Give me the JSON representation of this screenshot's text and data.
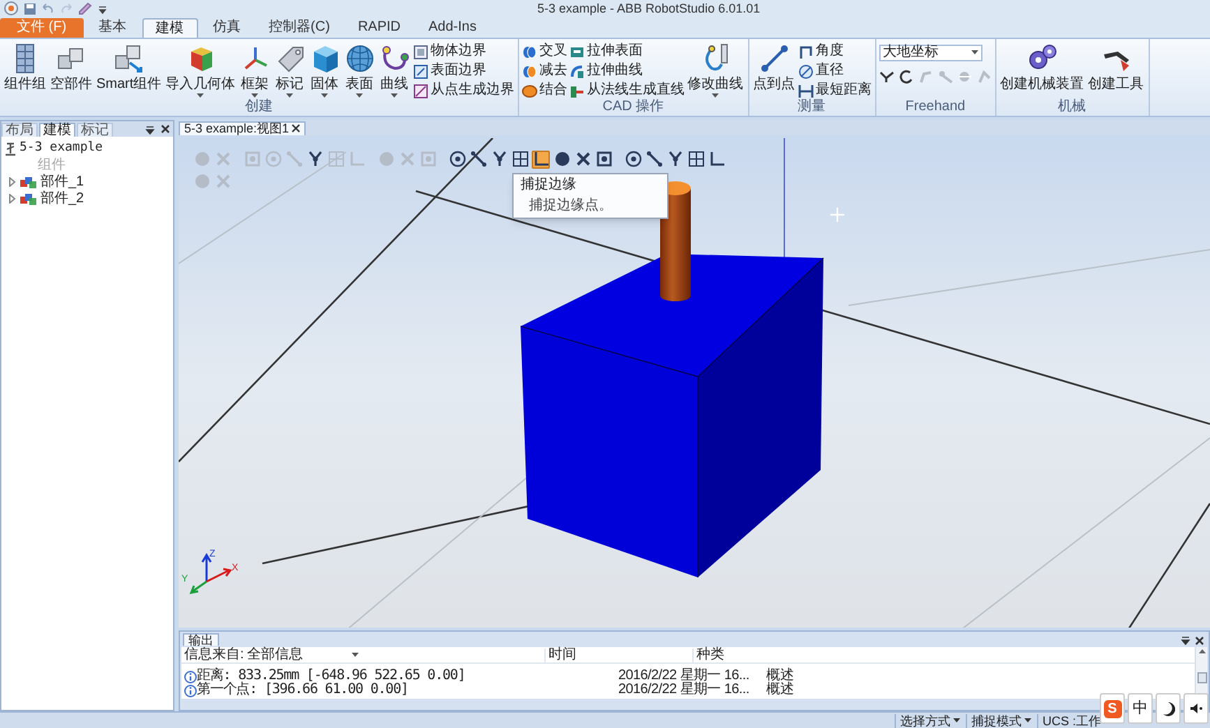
{
  "window": {
    "title": "5-3 example - ABB RobotStudio 6.01.01"
  },
  "ribbon": {
    "tabs": [
      {
        "label": "文件 (F)",
        "kind": "file",
        "selected": false
      },
      {
        "label": "基本",
        "kind": "tab",
        "selected": false
      },
      {
        "label": "建模",
        "kind": "tab",
        "selected": true
      },
      {
        "label": "仿真",
        "kind": "tab",
        "selected": false
      },
      {
        "label": "控制器(C)",
        "kind": "tab",
        "selected": false
      },
      {
        "label": "RAPID",
        "kind": "tab",
        "selected": false
      },
      {
        "label": "Add-Ins",
        "kind": "tab",
        "selected": false
      }
    ],
    "groups": [
      {
        "label": "创建",
        "items": [
          {
            "kind": "large",
            "label": "组件组",
            "dropdown": false
          },
          {
            "kind": "large",
            "label": "空部件",
            "dropdown": false
          },
          {
            "kind": "large",
            "label": "Smart组件",
            "dropdown": false
          },
          {
            "kind": "large",
            "label": "导入几何体",
            "dropdown": true
          },
          {
            "kind": "large",
            "label": "框架",
            "dropdown": true
          },
          {
            "kind": "large",
            "label": "标记",
            "dropdown": true
          },
          {
            "kind": "large",
            "label": "固体",
            "dropdown": true
          },
          {
            "kind": "large",
            "label": "表面",
            "dropdown": true
          },
          {
            "kind": "large",
            "label": "曲线",
            "dropdown": true
          },
          {
            "kind": "column",
            "items": [
              {
                "label": "物体边界"
              },
              {
                "label": "表面边界"
              },
              {
                "label": "从点生成边界"
              }
            ]
          }
        ]
      },
      {
        "label": "CAD 操作",
        "items": [
          {
            "kind": "column",
            "items": [
              {
                "label": "交叉"
              },
              {
                "label": "减去"
              },
              {
                "label": "结合"
              }
            ]
          },
          {
            "kind": "column",
            "items": [
              {
                "label": "拉伸表面"
              },
              {
                "label": "拉伸曲线"
              },
              {
                "label": "从法线生成直线"
              }
            ]
          },
          {
            "kind": "large",
            "label": "修改曲线",
            "dropdown": true
          }
        ]
      },
      {
        "label": "测量",
        "items": [
          {
            "kind": "large",
            "label": "点到点",
            "dropdown": false
          },
          {
            "kind": "column",
            "items": [
              {
                "label": "角度"
              },
              {
                "label": "直径"
              },
              {
                "label": "最短距离"
              }
            ]
          }
        ]
      },
      {
        "label": "Freehand",
        "items": [
          {
            "kind": "dropdown",
            "value": "大地坐标"
          }
        ]
      },
      {
        "label": "机械",
        "items": [
          {
            "kind": "large",
            "label": "创建机械装置",
            "dropdown": false
          },
          {
            "kind": "large",
            "label": "创建工具",
            "dropdown": false
          }
        ]
      }
    ]
  },
  "left_panel": {
    "tabs": [
      {
        "label": "布局",
        "selected": false
      },
      {
        "label": "建模",
        "selected": true
      },
      {
        "label": "标记",
        "selected": false
      }
    ],
    "tree": [
      {
        "label": "5-3 example",
        "children": [
          {
            "label": "组件",
            "disabled": true
          },
          {
            "label": "部件_1",
            "disabled": false,
            "expanded": false
          },
          {
            "label": "部件_2",
            "disabled": false,
            "expanded": false
          }
        ]
      }
    ]
  },
  "viewport": {
    "tab": "5-3 example:视图1",
    "toolbar": [
      [
        {
          "buttons": [
            {
              "disabled": true,
              "selected": false
            },
            {
              "disabled": true,
              "selected": false
            }
          ]
        },
        {
          "buttons": [
            {
              "disabled": true,
              "selected": false
            },
            {
              "disabled": true,
              "selected": false
            },
            {
              "disabled": true,
              "selected": false
            },
            {
              "disabled": false,
              "selected": false
            },
            {
              "disabled": true,
              "selected": false
            },
            {
              "disabled": true,
              "selected": false
            }
          ]
        },
        {
          "buttons": [
            {
              "disabled": true,
              "selected": false
            },
            {
              "disabled": true,
              "selected": false
            },
            {
              "disabled": true,
              "selected": false
            }
          ]
        },
        {
          "buttons": [
            {
              "disabled": false,
              "selected": false
            },
            {
              "disabled": false,
              "selected": false
            },
            {
              "disabled": false,
              "selected": false
            },
            {
              "disabled": false,
              "selected": false
            },
            {
              "disabled": false,
              "selected": true
            },
            {
              "disabled": false,
              "selected": false
            },
            {
              "disabled": false,
              "selected": false
            },
            {
              "disabled": false,
              "selected": false
            }
          ]
        },
        {
          "buttons": [
            {
              "disabled": false,
              "selected": false
            },
            {
              "disabled": false,
              "selected": false
            },
            {
              "disabled": false,
              "selected": false
            },
            {
              "disabled": false,
              "selected": false
            },
            {
              "disabled": false,
              "selected": false
            }
          ]
        }
      ],
      [
        {
          "buttons": [
            {
              "disabled": true,
              "selected": false
            },
            {
              "disabled": true,
              "selected": false
            }
          ]
        }
      ]
    ],
    "tooltip": {
      "title": "捕捉边缘",
      "text": "捕捉边缘点。"
    },
    "axis_labels": [
      "X",
      "Y",
      "Z"
    ]
  },
  "output": {
    "tab": "输出",
    "filter_label": "信息来自:",
    "filter_value": "全部信息",
    "columns": [
      "时间",
      "种类"
    ],
    "rows": [
      {
        "message": "距离: 833.25mm [-648.96 522.65 0.00]",
        "time": "2016/2/22 星期一 16...",
        "category": "概述"
      },
      {
        "message": "第一个点: [396.66 61.00 0.00]",
        "time": "2016/2/22 星期一 16...",
        "category": "概述"
      }
    ]
  },
  "status_bar": {
    "menus": [
      "选择方式",
      "捕捉模式"
    ],
    "ucs": "UCS :工作"
  },
  "ime_bar": {
    "logo": "S",
    "mode": "中"
  }
}
